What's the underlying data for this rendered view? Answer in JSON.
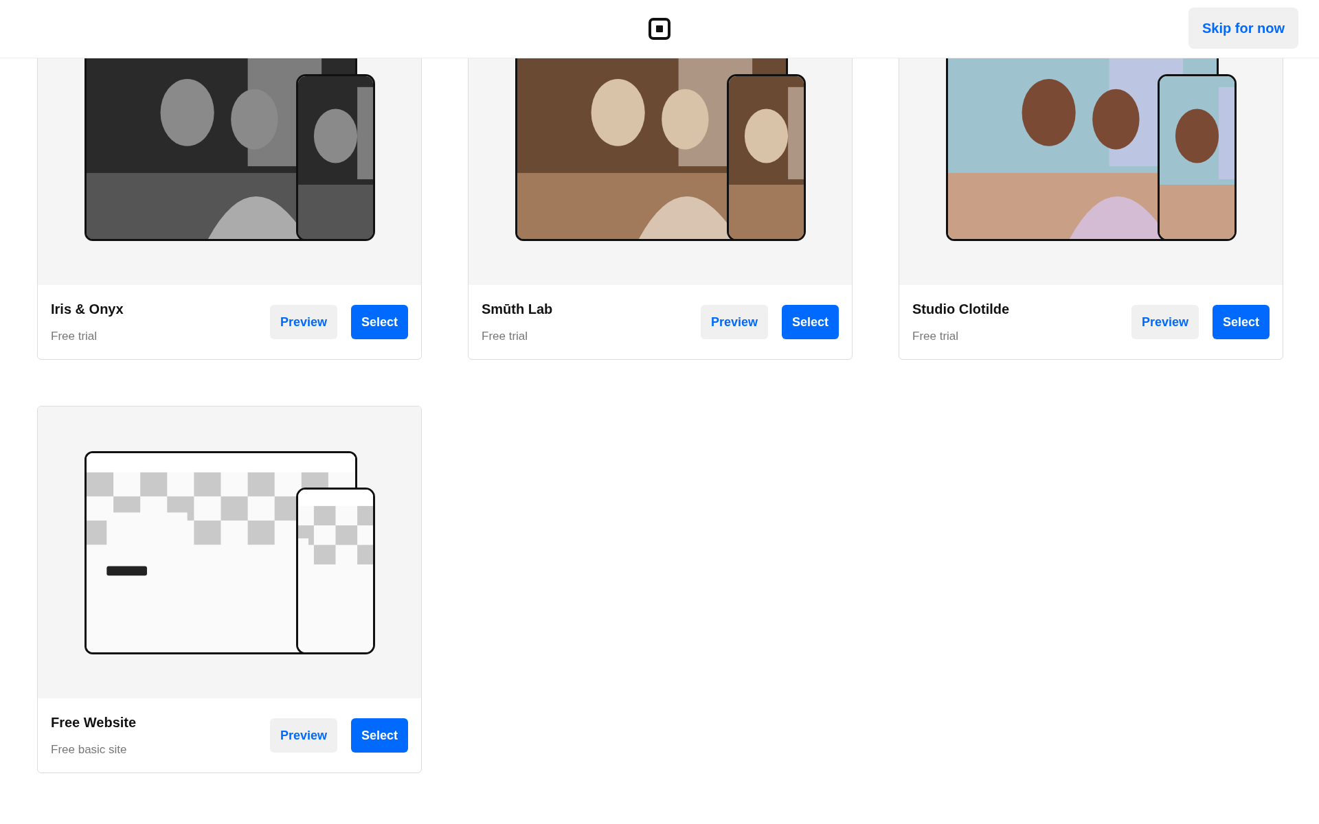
{
  "header": {
    "skip_button": "Skip for now"
  },
  "templates": [
    {
      "name": "Iris & Onyx",
      "plan": "Free trial",
      "preview_button": "Preview",
      "select_button": "Select"
    },
    {
      "name": "Smūth Lab",
      "plan": "Free trial",
      "preview_button": "Preview",
      "select_button": "Select"
    },
    {
      "name": "Studio Clotilde",
      "plan": "Free trial",
      "preview_button": "Preview",
      "select_button": "Select"
    },
    {
      "name": "Free Website",
      "plan": "Free basic site",
      "preview_button": "Preview",
      "select_button": "Select"
    }
  ]
}
